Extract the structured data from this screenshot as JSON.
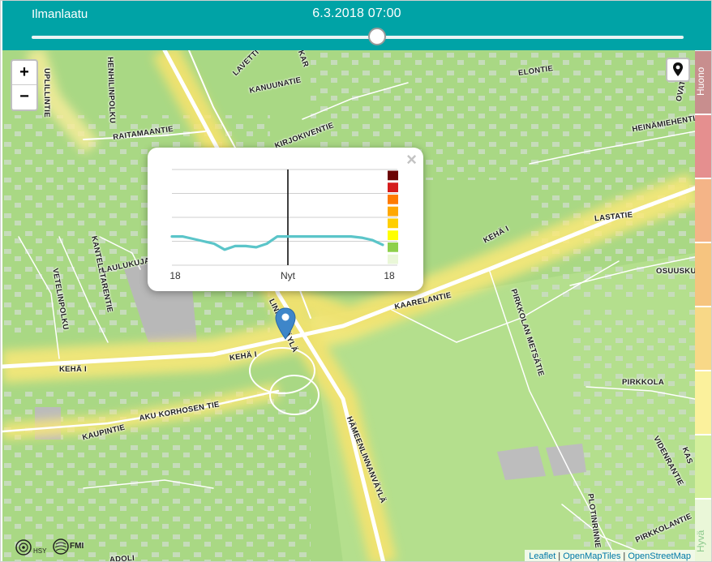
{
  "header": {
    "title": "Ilmanlaatu",
    "timestamp": "6.3.2018 07:00",
    "slider_fraction": 0.53
  },
  "zoom": {
    "in_label": "+",
    "out_label": "−"
  },
  "legend": {
    "top_label": "Huono",
    "bottom_label": "Hyvä",
    "colors": [
      "#c88e8e",
      "#e58f8f",
      "#f4b487",
      "#f6c47f",
      "#f8d887",
      "#fbf19c",
      "#d4ef9c",
      "#eaf7d8"
    ]
  },
  "streets": [
    "UPLILLINTIE",
    "HENHILINPOLKU",
    "RAITAMAANTIE",
    "LAVETTI",
    "KANUUNATIE",
    "KAR",
    "KIRJOKIVENTIE",
    "ELONTIE",
    "OVATIE",
    "HEINÄMIEHENTIE",
    "LASTATIE",
    "KEHÄ I",
    "OSUUSKU",
    "KANTELETARENTIE",
    "LAULUKUJA",
    "VETELINPOLKU",
    "LINNANVÄYLÄ",
    "KAARELANTIE",
    "PIRKKOLAN METSÄTIE",
    "KEHÄ I",
    "KEHÄ I",
    "PIRKKOLA",
    "AKU KORHOSEN TIE",
    "KAUPINTIE",
    "HÄMEENLINNANVÄYLÄ",
    "VIDENRANTIE",
    "KAS",
    "PLOTINRINNE",
    "PIRKKOLANTIE",
    "ADOLI"
  ],
  "popup": {
    "close_label": "×",
    "chart_data": {
      "type": "line",
      "x_tick_labels": [
        "18",
        "Nyt",
        "18"
      ],
      "now_index": 11,
      "y_range": [
        0,
        8
      ],
      "color_scale": [
        "#eaf7d8",
        "#8ed04b",
        "#ffff00",
        "#ffcf00",
        "#ffa800",
        "#ff7b00",
        "#d51c1c",
        "#6b0404"
      ],
      "line_color": "#5bc5c9",
      "series": [
        {
          "values": [
            2.4,
            2.4,
            2.2,
            2.0,
            1.8,
            1.3,
            1.6,
            1.6,
            1.5,
            1.8,
            2.4,
            2.4,
            2.4,
            2.4,
            2.4,
            2.4,
            2.4,
            2.4,
            2.3,
            2.1,
            1.7
          ]
        }
      ]
    }
  },
  "logos": {
    "hsy": "HSY",
    "fmi": "FMI"
  },
  "attribution": {
    "leaflet": "Leaflet",
    "sep": " | ",
    "omt": "OpenMapTiles",
    "osm": "OpenStreetMap"
  }
}
